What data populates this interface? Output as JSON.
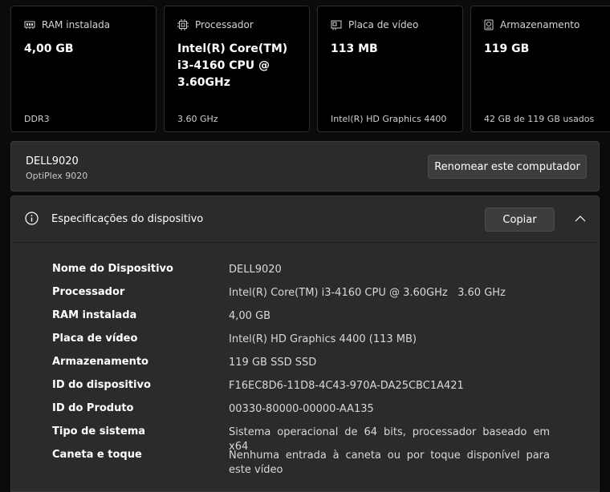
{
  "cards": [
    {
      "title": "RAM instalada",
      "icon": "ram-icon",
      "value": "4,00 GB",
      "footer": "DDR3"
    },
    {
      "title": "Processador",
      "icon": "processor-icon",
      "value": "Intel(R) Core(TM) i3-4160 CPU @ 3.60GHz",
      "footer": "3.60 GHz"
    },
    {
      "title": "Placa de vídeo",
      "icon": "gpu-icon",
      "value": "113 MB",
      "footer": "Intel(R) HD Graphics 4400"
    },
    {
      "title": "Armazenamento",
      "icon": "storage-icon",
      "value": "119 GB",
      "footer": "42 GB de 119 GB usados"
    }
  ],
  "device": {
    "name": "DELL9020",
    "model": "OptiPlex 9020",
    "rename_label": "Renomear este computador"
  },
  "specs": {
    "title": "Especificações do dispositivo",
    "copy_label": "Copiar",
    "icons": {
      "info": "info-icon",
      "collapse": "chevron-up-icon"
    },
    "rows": [
      {
        "label": "Nome do Dispositivo",
        "value": "DELL9020"
      },
      {
        "label": "Processador",
        "value": "Intel(R) Core(TM) i3-4160 CPU @ 3.60GHz   3.60 GHz"
      },
      {
        "label": "RAM instalada",
        "value": "4,00 GB"
      },
      {
        "label": "Placa de vídeo",
        "value": "Intel(R) HD Graphics 4400 (113 MB)"
      },
      {
        "label": "Armazenamento",
        "value": "119 GB SSD SSD"
      },
      {
        "label": "ID do dispositivo",
        "value": "F16EC8D6-11D8-4C43-970A-DA25CBC1A421"
      },
      {
        "label": "ID do Produto",
        "value": "00330-80000-00000-AA135"
      },
      {
        "label": "Tipo de sistema",
        "value": "Sistema operacional de 64 bits, processador baseado em x64"
      },
      {
        "label": "Caneta e toque",
        "value": "Nenhuma entrada à caneta ou por toque disponível para este vídeo"
      }
    ]
  }
}
